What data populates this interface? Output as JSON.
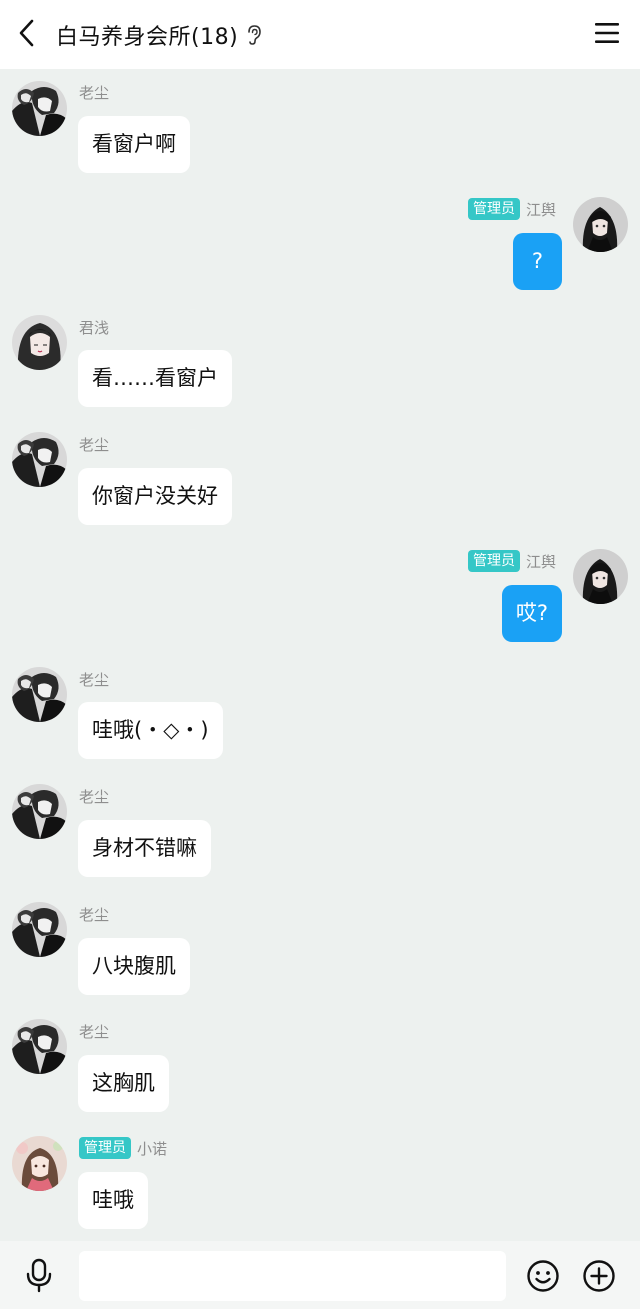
{
  "header": {
    "title": "白马养身会所(18)",
    "icons": [
      "back-arrow-icon",
      "ear-icon",
      "menu-icon"
    ]
  },
  "messages": [
    {
      "side": "left",
      "sender": "老尘",
      "badge": "",
      "text": "看窗户啊",
      "avatar": "laochen-avatar"
    },
    {
      "side": "right",
      "sender": "江舆",
      "badge": "管理员",
      "text": "?",
      "avatar": "jiangyu-avatar"
    },
    {
      "side": "left",
      "sender": "君浅",
      "badge": "",
      "text": "看……看窗户",
      "avatar": "junqian-avatar"
    },
    {
      "side": "left",
      "sender": "老尘",
      "badge": "",
      "text": "你窗户没关好",
      "avatar": "laochen-avatar"
    },
    {
      "side": "right",
      "sender": "江舆",
      "badge": "管理员",
      "text": "哎?",
      "avatar": "jiangyu-avatar"
    },
    {
      "side": "left",
      "sender": "老尘",
      "badge": "",
      "text": "哇哦(・◇・)",
      "avatar": "laochen-avatar"
    },
    {
      "side": "left",
      "sender": "老尘",
      "badge": "",
      "text": "身材不错嘛",
      "avatar": "laochen-avatar"
    },
    {
      "side": "left",
      "sender": "老尘",
      "badge": "",
      "text": "八块腹肌",
      "avatar": "laochen-avatar"
    },
    {
      "side": "left",
      "sender": "老尘",
      "badge": "",
      "text": "这胸肌",
      "avatar": "laochen-avatar"
    },
    {
      "side": "left",
      "sender": "小诺",
      "badge": "管理员",
      "text": "哇哦",
      "avatar": "xiaonuo-avatar"
    }
  ],
  "input": {
    "value": "",
    "placeholder": "",
    "icons": [
      "microphone-icon",
      "emoji-icon",
      "plus-icon"
    ]
  },
  "colors": {
    "background": "#edf1ef",
    "outgoing_bubble": "#1aa1f5",
    "incoming_bubble": "#ffffff",
    "admin_badge": "#35c7c7"
  }
}
